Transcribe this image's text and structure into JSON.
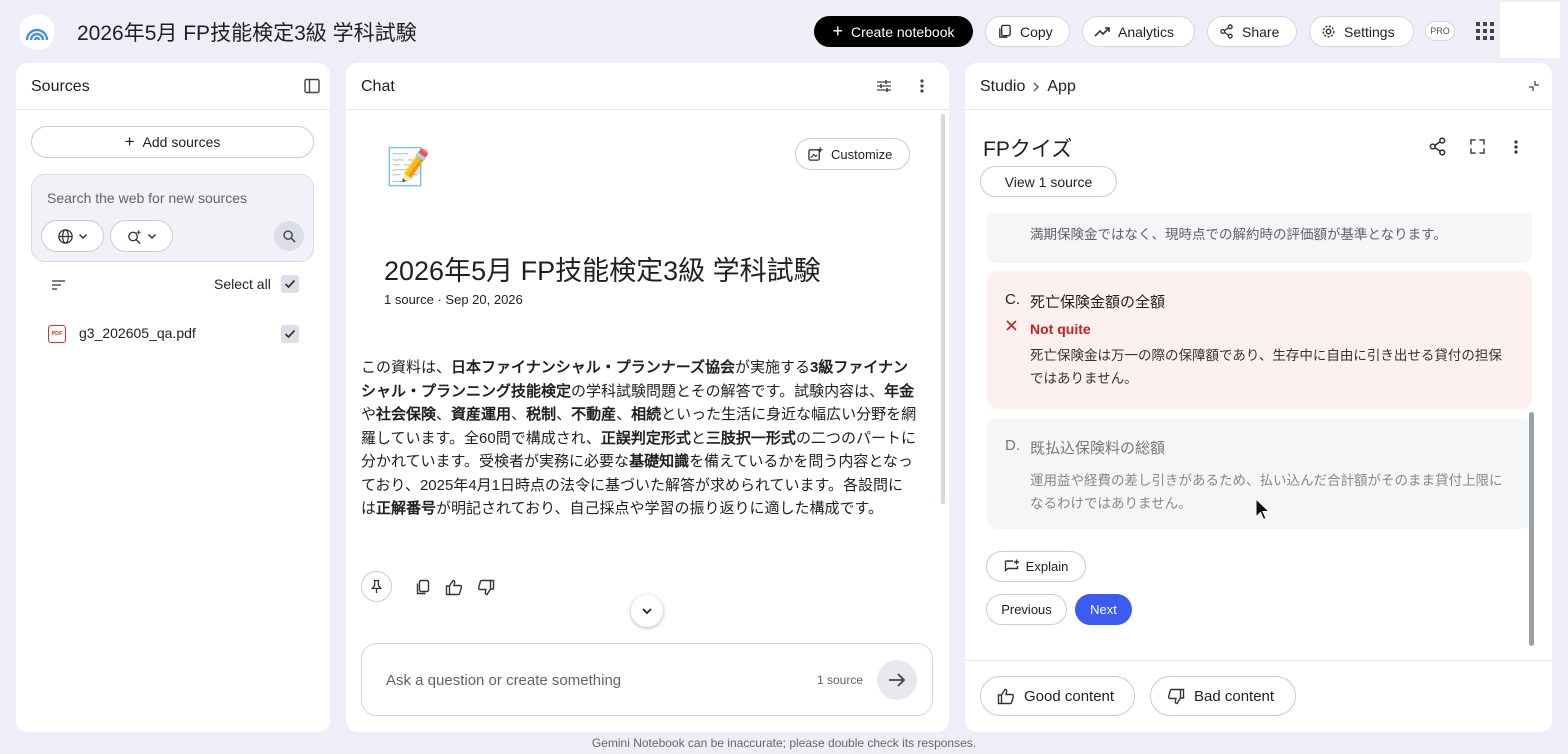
{
  "topbar": {
    "notebook_title": "2026年5月 FP技能検定3級 学科試験",
    "create_label": "Create notebook",
    "copy_label": "Copy",
    "analytics_label": "Analytics",
    "share_label": "Share",
    "settings_label": "Settings",
    "pro_badge": "PRO"
  },
  "sources": {
    "title": "Sources",
    "add_label": "Add sources",
    "search_placeholder": "Search the web for new sources",
    "select_all_label": "Select all",
    "items": [
      {
        "name": "g3_202605_qa.pdf",
        "type_badge": "PDF",
        "checked": true
      }
    ]
  },
  "chat": {
    "title": "Chat",
    "customize_label": "Customize",
    "emoji": "📝",
    "notebook_title": "2026年5月 FP技能検定3級 学科試験",
    "meta": "1 source · Sep 20, 2026",
    "summary": [
      {
        "t": "この資料は、",
        "b": false
      },
      {
        "t": "日本ファイナンシャル・プランナーズ協会",
        "b": true
      },
      {
        "t": "が実施する",
        "b": false
      },
      {
        "t": "3級ファイナンシャル・プランニング技能検定",
        "b": true
      },
      {
        "t": "の学科試験問題とその解答です。試験内容は、",
        "b": false
      },
      {
        "t": "年金",
        "b": true
      },
      {
        "t": "や",
        "b": false
      },
      {
        "t": "社会保険",
        "b": true
      },
      {
        "t": "、",
        "b": false
      },
      {
        "t": "資産運用",
        "b": true
      },
      {
        "t": "、",
        "b": false
      },
      {
        "t": "税制",
        "b": true
      },
      {
        "t": "、",
        "b": false
      },
      {
        "t": "不動産",
        "b": true
      },
      {
        "t": "、",
        "b": false
      },
      {
        "t": "相続",
        "b": true
      },
      {
        "t": "といった生活に身近な幅広い分野を網羅しています。全60問で構成され、",
        "b": false
      },
      {
        "t": "正誤判定形式",
        "b": true
      },
      {
        "t": "と",
        "b": false
      },
      {
        "t": "三肢択一形式",
        "b": true
      },
      {
        "t": "の二つのパートに分かれています。受検者が実務に必要な",
        "b": false
      },
      {
        "t": "基礎知識",
        "b": true
      },
      {
        "t": "を備えているかを問う内容となっており、2025年4月1日時点の法令に基づいた解答が求められています。各設問には",
        "b": false
      },
      {
        "t": "正解番号",
        "b": true
      },
      {
        "t": "が明記されており、自己採点や学習の振り返りに適した構成です。",
        "b": false
      }
    ],
    "input_placeholder": "Ask a question or create something",
    "source_count": "1 source"
  },
  "studio": {
    "crumb_root": "Studio",
    "crumb_current": "App",
    "app_title": "FPクイズ",
    "view_source_label": "View 1 source",
    "prev_option_tail": "満期保険金ではなく、現時点での解約時の評価額が基準となります。",
    "option_c": {
      "letter": "C.",
      "text": "死亡保険金額の全額",
      "verdict": "Not quite",
      "explanation": "死亡保険金は万一の際の保障額であり、生存中に自由に引き出せる貸付の担保ではありません。"
    },
    "option_d": {
      "letter": "D.",
      "text": "既払込保険料の総額",
      "explanation": "運用益や経費の差し引きがあるため、払い込んだ合計額がそのまま貸付上限になるわけではありません。"
    },
    "explain_label": "Explain",
    "previous_label": "Previous",
    "next_label": "Next",
    "good_label": "Good content",
    "bad_label": "Bad content"
  },
  "footer": {
    "disclaimer": "Gemini Notebook can be inaccurate; please double check its responses."
  },
  "colors": {
    "page_bg": "#eeeef8",
    "accent_blue": "#3c5bf0",
    "wrong_red": "#c5221f",
    "wrong_bg": "#fdf1f0",
    "option_bg": "#f5f6f8"
  }
}
